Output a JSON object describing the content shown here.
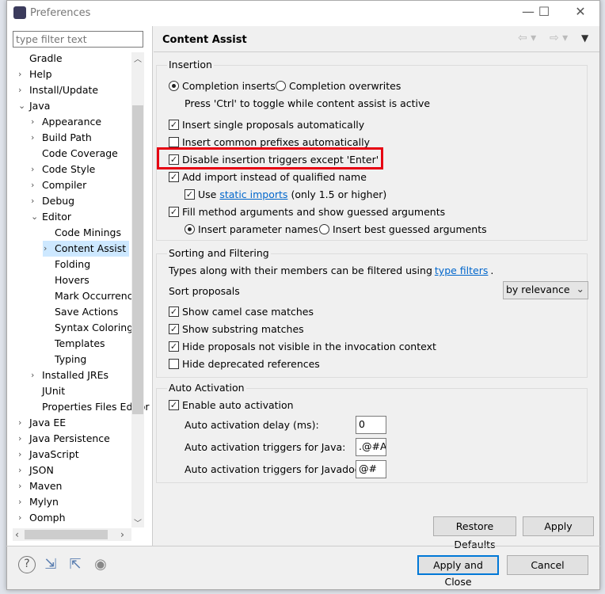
{
  "window": {
    "title": "Preferences",
    "minimize": "—",
    "maximize": "☐",
    "close": "✕"
  },
  "filter": {
    "placeholder": "type filter text"
  },
  "tree": [
    {
      "label": "Gradle",
      "level": 0,
      "chevron": ""
    },
    {
      "label": "Help",
      "level": 0,
      "chevron": "›"
    },
    {
      "label": "Install/Update",
      "level": 0,
      "chevron": "›"
    },
    {
      "label": "Java",
      "level": 0,
      "chevron": "⌄"
    },
    {
      "label": "Appearance",
      "level": 1,
      "chevron": "›"
    },
    {
      "label": "Build Path",
      "level": 1,
      "chevron": "›"
    },
    {
      "label": "Code Coverage",
      "level": 1,
      "chevron": ""
    },
    {
      "label": "Code Style",
      "level": 1,
      "chevron": "›"
    },
    {
      "label": "Compiler",
      "level": 1,
      "chevron": "›"
    },
    {
      "label": "Debug",
      "level": 1,
      "chevron": "›"
    },
    {
      "label": "Editor",
      "level": 1,
      "chevron": "⌄"
    },
    {
      "label": "Code Minings",
      "level": 2,
      "chevron": ""
    },
    {
      "label": "Content Assist",
      "level": 2,
      "chevron": "›",
      "selected": true
    },
    {
      "label": "Folding",
      "level": 2,
      "chevron": ""
    },
    {
      "label": "Hovers",
      "level": 2,
      "chevron": ""
    },
    {
      "label": "Mark Occurrences",
      "level": 2,
      "chevron": ""
    },
    {
      "label": "Save Actions",
      "level": 2,
      "chevron": ""
    },
    {
      "label": "Syntax Coloring",
      "level": 2,
      "chevron": ""
    },
    {
      "label": "Templates",
      "level": 2,
      "chevron": ""
    },
    {
      "label": "Typing",
      "level": 2,
      "chevron": ""
    },
    {
      "label": "Installed JREs",
      "level": 1,
      "chevron": "›"
    },
    {
      "label": "JUnit",
      "level": 1,
      "chevron": ""
    },
    {
      "label": "Properties Files Editor",
      "level": 1,
      "chevron": ""
    },
    {
      "label": "Java EE",
      "level": 0,
      "chevron": "›"
    },
    {
      "label": "Java Persistence",
      "level": 0,
      "chevron": "›"
    },
    {
      "label": "JavaScript",
      "level": 0,
      "chevron": "›"
    },
    {
      "label": "JSON",
      "level": 0,
      "chevron": "›"
    },
    {
      "label": "Maven",
      "level": 0,
      "chevron": "›"
    },
    {
      "label": "Mylyn",
      "level": 0,
      "chevron": "›"
    },
    {
      "label": "Oomph",
      "level": 0,
      "chevron": "›"
    }
  ],
  "page": {
    "title": "Content Assist"
  },
  "insertion": {
    "label": "Insertion",
    "completion_inserts": "Completion inserts",
    "completion_overwrites": "Completion overwrites",
    "toggle_hint": "Press 'Ctrl' to toggle while content assist is active",
    "single_proposals": "Insert single proposals automatically",
    "common_prefixes": "Insert common prefixes automatically",
    "disable_triggers": "Disable insertion triggers except 'Enter'",
    "add_import": "Add import instead of qualified name",
    "use": "Use",
    "static_imports": "static imports",
    "only_15": "(only 1.5 or higher)",
    "fill_args": "Fill method arguments and show guessed arguments",
    "insert_param_names": "Insert parameter names",
    "insert_best_guessed": "Insert best guessed arguments"
  },
  "sorting": {
    "label": "Sorting and Filtering",
    "types_text": "Types along with their members can be filtered using",
    "type_filters": "type filters",
    "period": ".",
    "sort_proposals": "Sort proposals",
    "sort_value": "by relevance",
    "camel": "Show camel case matches",
    "substring": "Show substring matches",
    "hide_not_visible": "Hide proposals not visible in the invocation context",
    "hide_deprecated": "Hide deprecated references"
  },
  "auto": {
    "label": "Auto Activation",
    "enable": "Enable auto activation",
    "delay_label": "Auto activation delay (ms):",
    "delay": "0",
    "java_label": "Auto activation triggers for Java:",
    "java": ".@#A",
    "javadoc_label": "Auto activation triggers for Javadoc:",
    "javadoc": "@#"
  },
  "buttons": {
    "restore": "Restore Defaults",
    "apply": "Apply",
    "apply_close": "Apply and Close",
    "cancel": "Cancel"
  },
  "highlight_color": "#e60012"
}
